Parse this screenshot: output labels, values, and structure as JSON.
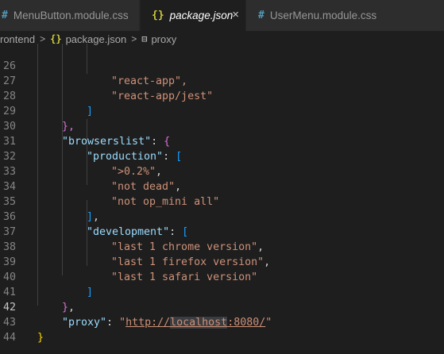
{
  "tabs": [
    {
      "icon": "#",
      "label": "MenuButton.module.css",
      "icon_color": "#519aba"
    },
    {
      "icon": "{}",
      "label": "package.json",
      "icon_color": "#cbcb41",
      "close": "×"
    },
    {
      "icon": "#",
      "label": "UserMenu.module.css",
      "icon_color": "#519aba"
    }
  ],
  "breadcrumb": {
    "folder": "rontend",
    "sep": ">",
    "file_icon": "{}",
    "file": "package.json",
    "symbol_icon": "⊟",
    "symbol": "proxy"
  },
  "editor": {
    "active_line": "42",
    "line_numbers": [
      "26",
      "27",
      "28",
      "29",
      "30",
      "31",
      "32",
      "33",
      "34",
      "35",
      "36",
      "37",
      "38",
      "39",
      "40",
      "41",
      "42",
      "43",
      "44"
    ],
    "lines": {
      "l26": "\"react-app\",",
      "l27": "\"react-app/jest\"",
      "l28": "]",
      "l29": "},",
      "l30_key": "\"browserslist\"",
      "l30_colon": ": ",
      "l30_brace": "{",
      "l31_key": "\"production\"",
      "l31_colon": ": ",
      "l31_bracket": "[",
      "l32": "\">0.2%\"",
      "l32_comma": ",",
      "l33": "\"not dead\"",
      "l33_comma": ",",
      "l34": "\"not op_mini all\"",
      "l35": "]",
      "l35_comma": ",",
      "l36_key": "\"development\"",
      "l36_colon": ": ",
      "l36_bracket": "[",
      "l37": "\"last 1 chrome version\"",
      "l37_comma": ",",
      "l38": "\"last 1 firefox version\"",
      "l38_comma": ",",
      "l39": "\"last 1 safari version\"",
      "l40": "]",
      "l41": "}",
      "l41_comma": ",",
      "l42_key": "\"proxy\"",
      "l42_colon": ": ",
      "l42_q1": "\"",
      "l42_url_a": "http://",
      "l42_url_b": "localhost",
      "l42_url_c": ":8080/",
      "l42_q2": "\"",
      "l43": "}"
    }
  }
}
